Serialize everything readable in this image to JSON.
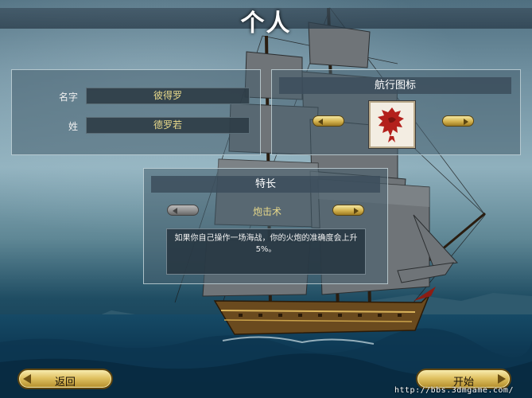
{
  "header": {
    "title": "个人"
  },
  "name_panel": {
    "first_name_label": "名字",
    "first_name_value": "彼得罗",
    "last_name_label": "姓",
    "last_name_value": "德罗若"
  },
  "emblem_panel": {
    "title": "航行图标",
    "emblem_icon": "red-dragon-emblem"
  },
  "skill_panel": {
    "title": "特长",
    "skill_value": "炮击术",
    "description": "如果你自己操作一场海战，你的火炮的准确度会上升5%。"
  },
  "footer": {
    "back_label": "返回",
    "start_label": "开始"
  },
  "watermark": "http://bbs.3dmgame.com/",
  "colors": {
    "accent_gold": "#d3b24e",
    "value_text": "#e8d98a",
    "emblem_red": "#b3201c"
  }
}
